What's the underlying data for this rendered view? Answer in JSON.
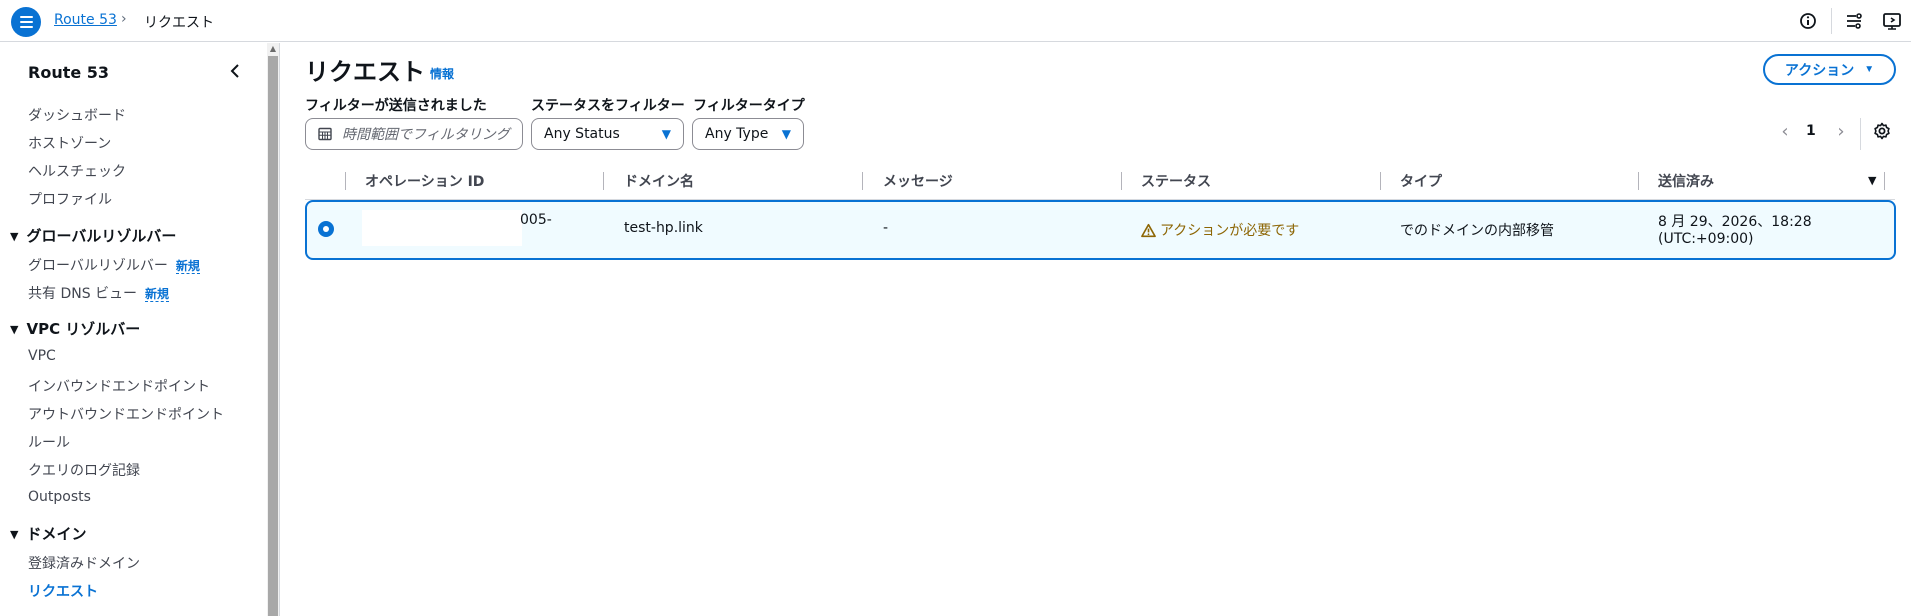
{
  "breadcrumb": {
    "root": "Route 53",
    "separator": "›",
    "current": "リクエスト"
  },
  "sidebar": {
    "title": "Route 53",
    "items_top": [
      "ダッシュボード",
      "ホストゾーン",
      "ヘルスチェック",
      "プロファイル"
    ],
    "sections": [
      {
        "title": "グローバルリゾルバー",
        "items": [
          {
            "label": "グローバルリゾルバー",
            "badge": "新規"
          },
          {
            "label": "共有 DNS ビュー",
            "badge": "新規"
          }
        ]
      },
      {
        "title": "VPC リゾルバー",
        "items": [
          {
            "label": "VPC"
          },
          {
            "label": "インバウンドエンドポイント"
          },
          {
            "label": "アウトバウンドエンドポイント"
          },
          {
            "label": "ルール"
          },
          {
            "label": "クエリのログ記録"
          },
          {
            "label": "Outposts"
          }
        ]
      },
      {
        "title": "ドメイン",
        "items": [
          {
            "label": "登録済みドメイン"
          },
          {
            "label": "リクエスト"
          }
        ]
      }
    ]
  },
  "page": {
    "title": "リクエスト",
    "info": "情報",
    "action_button": "アクション"
  },
  "filters": {
    "date_label": "フィルターが送信されました",
    "date_placeholder": "時間範囲でフィルタリング",
    "status_label": "ステータスをフィルター",
    "status_value": "Any Status",
    "type_label": "フィルタータイプ",
    "type_value": "Any Type"
  },
  "pagination": {
    "current_page": "1"
  },
  "table": {
    "columns": [
      "オペレーション ID",
      "ドメイン名",
      "メッセージ",
      "ステータス",
      "タイプ",
      "送信済み"
    ],
    "rows": [
      {
        "operation_id": "005-",
        "domain": "test-hp.link",
        "message": "-",
        "status": "アクションが必要です",
        "type": "でのドメインの内部移管",
        "submitted_line1": "8 月 29、2026、18:28",
        "submitted_line2": "(UTC:+09:00)"
      }
    ]
  },
  "colors": {
    "accent": "#0972d3",
    "warning": "#8d6605",
    "selected_row_bg": "#f0fbff"
  }
}
